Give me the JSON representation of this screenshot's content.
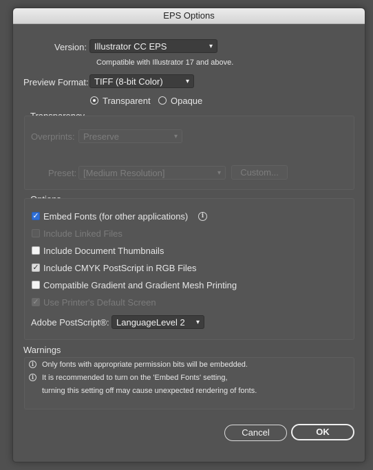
{
  "window": {
    "title": "EPS Options"
  },
  "version": {
    "label": "Version:",
    "value": "Illustrator CC EPS",
    "note": "Compatible with Illustrator 17 and above."
  },
  "preview": {
    "label": "Preview Format:",
    "value": "TIFF (8-bit Color)",
    "radio_transparent": "Transparent",
    "radio_opaque": "Opaque",
    "selected": "Transparent"
  },
  "transparency": {
    "title": "Transparency",
    "overprints_label": "Overprints:",
    "overprints_value": "Preserve",
    "preset_label": "Preset:",
    "preset_value": "[Medium Resolution]",
    "custom_button": "Custom..."
  },
  "options": {
    "title": "Options",
    "items": [
      {
        "label": "Embed Fonts (for other applications)",
        "checked": true,
        "enabled": true
      },
      {
        "label": "Include Linked Files",
        "checked": false,
        "enabled": false
      },
      {
        "label": "Include Document Thumbnails",
        "checked": false,
        "enabled": true
      },
      {
        "label": "Include CMYK PostScript in RGB Files",
        "checked": true,
        "enabled": true
      },
      {
        "label": "Compatible Gradient and Gradient Mesh Printing",
        "checked": false,
        "enabled": true
      },
      {
        "label": "Use Printer's Default Screen",
        "checked": true,
        "enabled": false
      }
    ],
    "postscript_label": "Adobe PostScript®:",
    "postscript_value": "LanguageLevel 2"
  },
  "warnings": {
    "title": "Warnings",
    "line1": "Only fonts with appropriate permission bits will be embedded.",
    "line2a": "It is recommended to turn on the 'Embed Fonts' setting,",
    "line2b": "turning this setting off may cause unexpected rendering of fonts."
  },
  "buttons": {
    "cancel": "Cancel",
    "ok": "OK"
  },
  "icons": {
    "info": "info-icon",
    "chevron": "chevron-down-icon",
    "check": "checkmark-icon"
  },
  "colors": {
    "accent": "#2f6fd6",
    "panel": "#535353"
  }
}
